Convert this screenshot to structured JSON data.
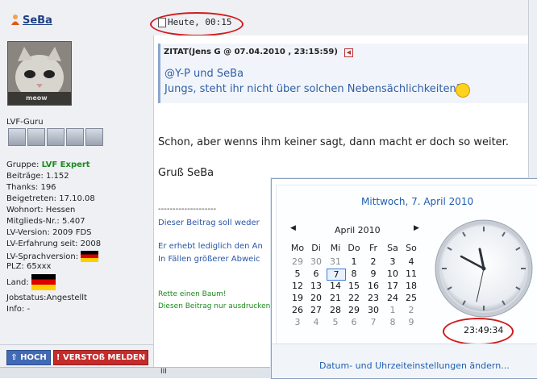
{
  "post": {
    "username": "SeBa",
    "date": "Heute, 00:15"
  },
  "user": {
    "avatar_caption": "meow",
    "rank": "LVF-Guru",
    "rank_bars": 5,
    "group_label": "Gruppe:",
    "group_value": "LVF Expert",
    "lines": [
      "Beiträge: 1.152",
      "Thanks: 196",
      "Beigetreten: 17.10.08",
      "Wohnort: Hessen",
      "Mitglieds-Nr.: 5.407",
      "LV-Version: 2009 FDS",
      "LV-Erfahrung seit: 2008",
      "LV-Sprachversion:",
      "PLZ: 65xxx",
      "Land:",
      "Jobstatus:Angestellt",
      "Info: -"
    ]
  },
  "quote": {
    "header": "ZITAT(Jens G @ 07.04.2010 , 23:15:59)",
    "line1": "@Y-P und SeBa",
    "line2": "Jungs, steht ihr nicht über solchen Nebensächlichkeiten?"
  },
  "body": {
    "line1": "Schon, aber wenns ihm keiner sagt, dann macht er doch so weiter.",
    "greeting": "Gruß SeBa"
  },
  "signature": {
    "separator": "--------------------",
    "line1": "Dieser Beitrag soll weder",
    "line2": "Er erhebt lediglich den An",
    "line3": "In Fällen größerer Abweic",
    "green1": "Rette einen Baum!",
    "green2": "Diesen Beitrag nur ausdrucken"
  },
  "buttons": {
    "up": "HOCH",
    "report": "VERSTOß MELDEN"
  },
  "grip": "III",
  "calendar": {
    "header": "Mittwoch, 7. April 2010",
    "month": "April 2010",
    "prev": "◀",
    "next": "▶",
    "weekdays": [
      "Mo",
      "Di",
      "Mi",
      "Do",
      "Fr",
      "Sa",
      "So"
    ],
    "weeks": [
      [
        "29",
        "30",
        "31",
        "1",
        "2",
        "3",
        "4"
      ],
      [
        "5",
        "6",
        "7",
        "8",
        "9",
        "10",
        "11"
      ],
      [
        "12",
        "13",
        "14",
        "15",
        "16",
        "17",
        "18"
      ],
      [
        "19",
        "20",
        "21",
        "22",
        "23",
        "24",
        "25"
      ],
      [
        "26",
        "27",
        "28",
        "29",
        "30",
        "1",
        "2"
      ],
      [
        "3",
        "4",
        "5",
        "6",
        "7",
        "8",
        "9"
      ]
    ],
    "other_month": [
      [
        0,
        0
      ],
      [
        0,
        1
      ],
      [
        0,
        2
      ],
      [
        4,
        5
      ],
      [
        4,
        6
      ],
      [
        5,
        0
      ],
      [
        5,
        1
      ],
      [
        5,
        2
      ],
      [
        5,
        3
      ],
      [
        5,
        4
      ],
      [
        5,
        5
      ],
      [
        5,
        6
      ]
    ],
    "today": [
      1,
      2
    ],
    "time": "23:49:34",
    "settings_link": "Datum- und Uhrzeiteinstellungen ändern..."
  },
  "colors": {
    "accent": "#1f5eb0",
    "highlight_ring": "#d21a1a"
  }
}
